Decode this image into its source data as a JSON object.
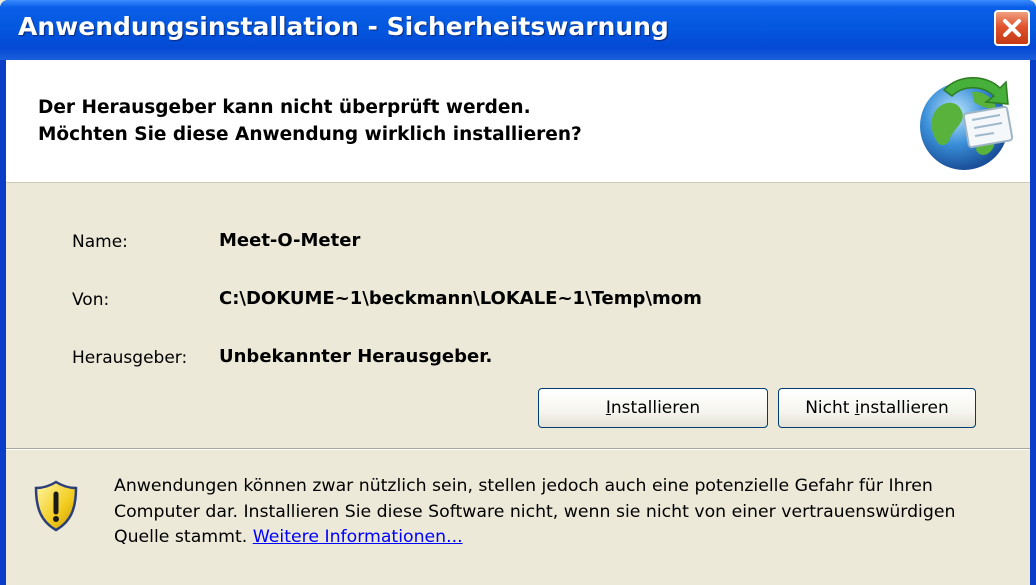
{
  "window": {
    "title": "Anwendungsinstallation - Sicherheitswarnung",
    "close_icon": "close-icon"
  },
  "header": {
    "line1": "Der Herausgeber kann nicht überprüft werden.",
    "line2": "Möchten Sie diese Anwendung wirklich installieren?",
    "icon": "globe-install-icon"
  },
  "details": [
    {
      "label": "Name:",
      "value": "Meet-O-Meter"
    },
    {
      "label": "Von:",
      "value": "C:\\DOKUME~1\\beckmann\\LOKALE~1\\Temp\\mom"
    },
    {
      "label": "Herausgeber:",
      "value": "Unbekannter Herausgeber."
    }
  ],
  "buttons": {
    "install": {
      "label_access": "I",
      "label_rest": "nstallieren"
    },
    "dont_install": {
      "label_pre": "Nicht ",
      "label_access": "i",
      "label_rest": "nstallieren"
    }
  },
  "warning": {
    "icon": "shield-warning-icon",
    "text": "Anwendungen können zwar nützlich sein, stellen jedoch auch eine potenzielle Gefahr für Ihren Computer dar. Installieren Sie diese Software nicht, wenn sie nicht von einer vertrauenswürdigen Quelle stammt. ",
    "link": "Weitere Informationen..."
  },
  "colors": {
    "titlebar": "#0458e0",
    "client_bg": "#ece9d8",
    "link": "#0000ff",
    "close_button": "#e0532e"
  }
}
